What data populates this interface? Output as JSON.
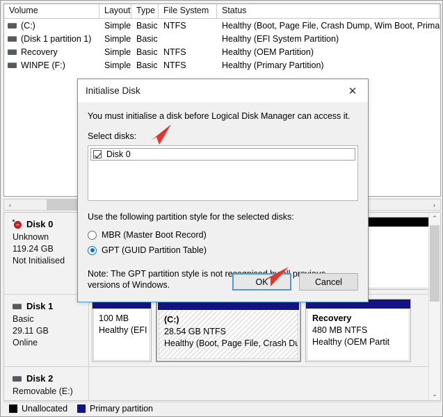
{
  "volume_list": {
    "columns": [
      "Volume",
      "Layout",
      "Type",
      "File System",
      "Status"
    ],
    "rows": [
      {
        "icon": "disk-icon",
        "volume": "(C:)",
        "layout": "Simple",
        "type": "Basic",
        "file_system": "NTFS",
        "status": "Healthy (Boot, Page File, Crash Dump, Wim Boot, Primary"
      },
      {
        "icon": "disk-icon",
        "volume": "(Disk 1 partition 1)",
        "layout": "Simple",
        "type": "Basic",
        "file_system": "",
        "status": "Healthy (EFI System Partition)"
      },
      {
        "icon": "disk-icon",
        "volume": "Recovery",
        "layout": "Simple",
        "type": "Basic",
        "file_system": "NTFS",
        "status": "Healthy (OEM Partition)"
      },
      {
        "icon": "disk-icon",
        "volume": "WINPE (F:)",
        "layout": "Simple",
        "type": "Basic",
        "file_system": "NTFS",
        "status": "Healthy (Primary Partition)"
      }
    ]
  },
  "scrollbars": {
    "horizontal_left_arrow": "‹",
    "horizontal_right_arrow": "›",
    "vertical_up_arrow": "⌃",
    "vertical_down_arrow": "⌄"
  },
  "disk_pane": {
    "disks": [
      {
        "icon": "disk-error-icon",
        "name": "Disk 0",
        "type": "Unknown",
        "capacity": "119.24 GB",
        "state": "Not Initialised",
        "partitions": [
          {
            "kind": "unallocated",
            "bar_color": "#000000",
            "lines": []
          }
        ]
      },
      {
        "icon": "disk-icon",
        "name": "Disk 1",
        "type": "Basic",
        "capacity": "29.11 GB",
        "state": "Online",
        "partitions": [
          {
            "kind": "primary",
            "bar_color": "#131387",
            "title": "",
            "size": "100 MB",
            "health": "Healthy (EFI S"
          },
          {
            "kind": "primary-selected",
            "bar_color": "#131387",
            "title": "(C:)",
            "size": "28.54 GB NTFS",
            "health": "Healthy (Boot, Page File, Crash Dum"
          },
          {
            "kind": "primary",
            "bar_color": "#131387",
            "title": "Recovery",
            "size": "480 MB NTFS",
            "health": "Healthy (OEM Partit"
          }
        ]
      },
      {
        "icon": "disk-icon",
        "name": "Disk 2",
        "type": "Removable (E:)",
        "capacity": "",
        "state": "",
        "partitions": []
      }
    ]
  },
  "legend": {
    "items": [
      {
        "label": "Unallocated",
        "color": "#000000"
      },
      {
        "label": "Primary partition",
        "color": "#131387"
      }
    ]
  },
  "dialog": {
    "title": "Initialise Disk",
    "close_label": "✕",
    "intro": "You must initialise a disk before Logical Disk Manager can access it.",
    "select_disks_label": "Select disks:",
    "disk_items": [
      {
        "label": "Disk 0",
        "checked": true
      }
    ],
    "partition_style_label": "Use the following partition style for the selected disks:",
    "options": [
      {
        "label": "MBR (Master Boot Record)",
        "selected": false
      },
      {
        "label": "GPT (GUID Partition Table)",
        "selected": true
      }
    ],
    "note": "Note: The GPT partition style is not recognised by all previous versions of Windows.",
    "ok_label": "OK",
    "cancel_label": "Cancel",
    "accent_color": "#0a72c4"
  },
  "annotations": {
    "arrow_color": "#e8332a",
    "arrows": [
      {
        "name": "arrow-to-disk-list"
      },
      {
        "name": "arrow-to-ok-button"
      }
    ]
  }
}
